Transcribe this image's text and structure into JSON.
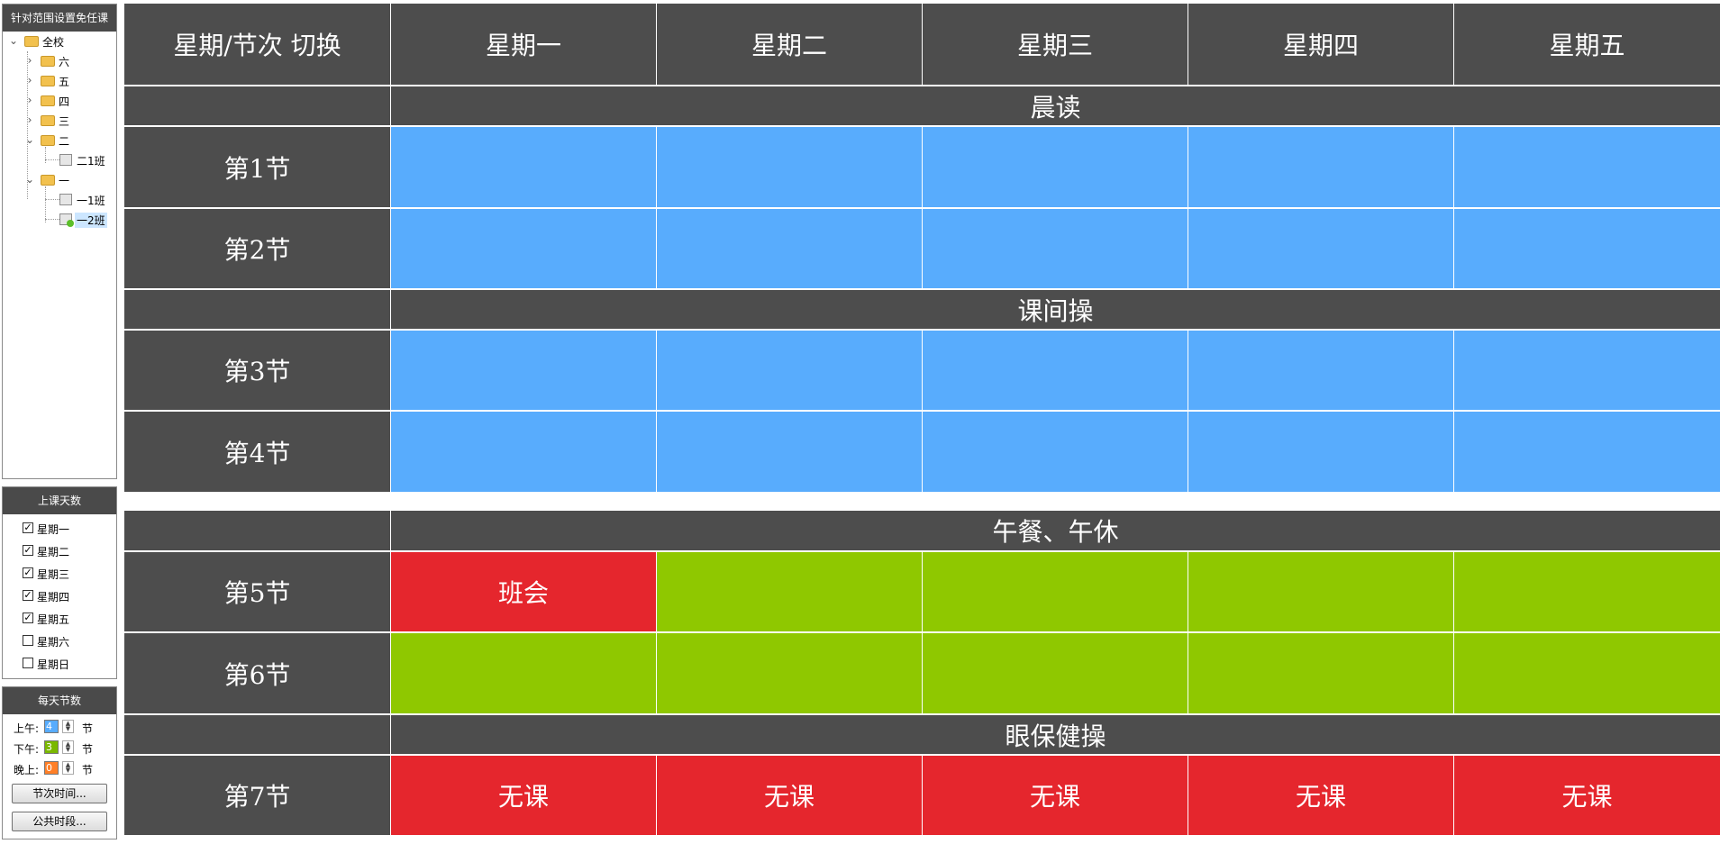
{
  "sidebar": {
    "tree_title": "针对范围设置免任课",
    "tree": [
      {
        "label": "全校",
        "type": "folder",
        "expander": "⌄"
      },
      {
        "label": "六",
        "type": "folder",
        "expander": "›"
      },
      {
        "label": "五",
        "type": "folder",
        "expander": "›"
      },
      {
        "label": "四",
        "type": "folder",
        "expander": "›"
      },
      {
        "label": "三",
        "type": "folder",
        "expander": "›"
      },
      {
        "label": "二",
        "type": "folder",
        "expander": "⌄"
      },
      {
        "label": "二1班",
        "type": "class"
      },
      {
        "label": "一",
        "type": "folder",
        "expander": "⌄"
      },
      {
        "label": "一1班",
        "type": "class"
      },
      {
        "label": "一2班",
        "type": "class",
        "selected": true
      }
    ],
    "days_title": "上课天数",
    "days": [
      {
        "label": "星期一",
        "checked": true
      },
      {
        "label": "星期二",
        "checked": true
      },
      {
        "label": "星期三",
        "checked": true
      },
      {
        "label": "星期四",
        "checked": true
      },
      {
        "label": "星期五",
        "checked": true
      },
      {
        "label": "星期六",
        "checked": false
      },
      {
        "label": "星期日",
        "checked": false
      }
    ],
    "periods_title": "每天节数",
    "periods": [
      {
        "label": "上午:",
        "value": "4",
        "unit": "节",
        "color": "#58acfd"
      },
      {
        "label": "下午:",
        "value": "3",
        "unit": "节",
        "color": "#7ab800"
      },
      {
        "label": "晚上:",
        "value": "0",
        "unit": "节",
        "color": "#ff7f27"
      }
    ],
    "btn_period_time": "节次时间...",
    "btn_common_time": "公共时段..."
  },
  "grid": {
    "corner_label": "星期/节次 切换",
    "days": [
      "星期一",
      "星期二",
      "星期三",
      "星期四",
      "星期五"
    ],
    "morning_break": "晨读",
    "mid_break": "课间操",
    "lunch_break": "午餐、午休",
    "eye_break": "眼保健操",
    "periods": {
      "p1": "第1节",
      "p2": "第2节",
      "p3": "第3节",
      "p4": "第4节",
      "p5": "第5节",
      "p6": "第6节",
      "p7": "第7节"
    },
    "cell_p5_mon": "班会",
    "no_class": "无课",
    "colors": {
      "header": "#4d4d4d",
      "morning": "#58acfd",
      "afternoon": "#8fc800",
      "blocked": "#e5262d"
    }
  }
}
